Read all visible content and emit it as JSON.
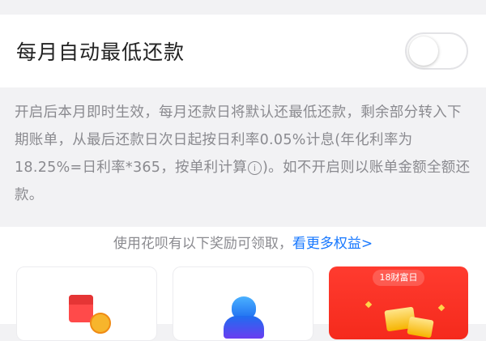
{
  "setting": {
    "label": "每月自动最低还款",
    "toggle_on": false
  },
  "description": {
    "text_before_icon": "开启后本月即时生效，每月还款日将默认还最低还款，剩余部分转入下期账单，从最后还款日次日起按日利率0.05%计息(年化利率为18.25%=日利率*365，按单利计算",
    "info_icon_glyph": "i",
    "text_after_icon": ")。如不开启则以账单金额全额还款。"
  },
  "rewards": {
    "header_text": "使用花呗有以下奖励可领取，",
    "link_text": "看更多权益>",
    "link_color": "#1677ff",
    "cards": [
      {
        "icon": "red-envelope-coin-icon"
      },
      {
        "icon": "blue-figure-icon"
      },
      {
        "ribbon_text": "18财富日",
        "icon": "gold-bars-icon",
        "background": "#ff3b2f"
      }
    ]
  }
}
